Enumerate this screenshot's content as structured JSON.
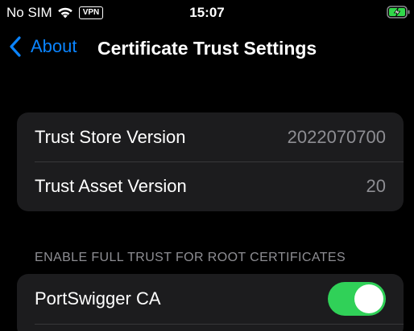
{
  "status_bar": {
    "carrier": "No SIM",
    "vpn": "VPN",
    "time": "15:07",
    "battery_color": "#32d74b"
  },
  "nav": {
    "back_label": "About",
    "title": "Certificate Trust Settings",
    "accent_color": "#0a84ff"
  },
  "versions": [
    {
      "label": "Trust Store Version",
      "value": "2022070700"
    },
    {
      "label": "Trust Asset Version",
      "value": "20"
    }
  ],
  "certificates": {
    "header": "ENABLE FULL TRUST FOR ROOT CERTIFICATES",
    "items": [
      {
        "label": "PortSwigger CA",
        "enabled": true
      }
    ]
  }
}
